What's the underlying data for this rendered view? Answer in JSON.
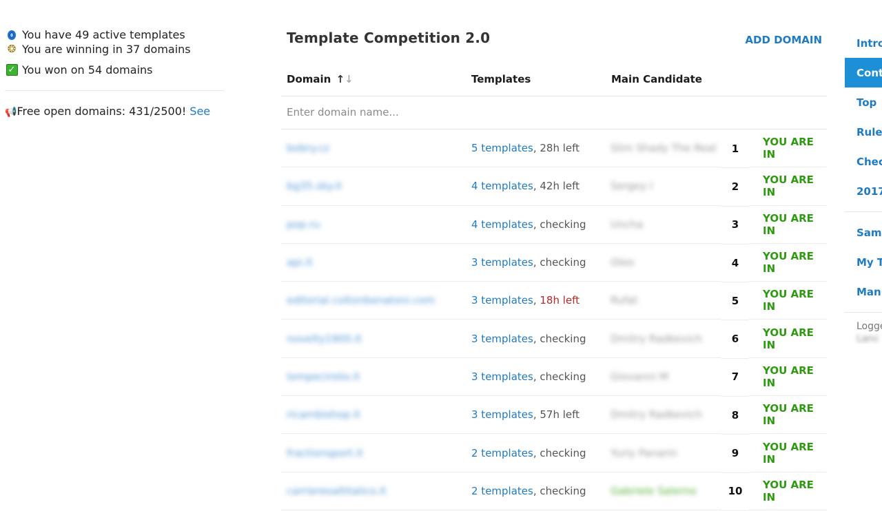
{
  "status": {
    "active_templates": "You have 49 active templates",
    "winning": "You are winning in 37 domains",
    "won": "You won on 54 domains",
    "free_domains": "Free open domains: 431/2500!",
    "see_link": "See"
  },
  "main": {
    "title": "Template Competition 2.0",
    "add_domain": "ADD DOMAIN"
  },
  "table": {
    "headers": {
      "domain": "Domain",
      "domain_sort_up": "↑",
      "domain_sort_down": "↓",
      "templates": "Templates",
      "candidate": "Main Candidate"
    },
    "search_placeholder": "Enter domain name...",
    "rows": [
      {
        "domain": "bobry.cz",
        "templates": "5 templates",
        "sep": ", ",
        "time": "28h left",
        "urgent": false,
        "candidate": "Slim Shady The Real",
        "rank": "1",
        "status": "YOU ARE IN"
      },
      {
        "domain": "bg35.sky.it",
        "templates": "4 templates",
        "sep": ", ",
        "time": "42h left",
        "urgent": false,
        "candidate": "Sergey I",
        "rank": "2",
        "status": "YOU ARE IN"
      },
      {
        "domain": "pop.ru",
        "templates": "4 templates",
        "sep": ", ",
        "time": "checking",
        "urgent": false,
        "candidate": "Uncha",
        "rank": "3",
        "status": "YOU ARE IN"
      },
      {
        "domain": "api.it",
        "templates": "3 templates",
        "sep": ", ",
        "time": "checking",
        "urgent": false,
        "candidate": "Oleo",
        "rank": "4",
        "status": "YOU ARE IN"
      },
      {
        "domain": "editorial.coltonbenatoni.com",
        "templates": "3 templates",
        "sep": ", ",
        "time": "18h left",
        "urgent": true,
        "candidate": "Rufat",
        "rank": "5",
        "status": "YOU ARE IN"
      },
      {
        "domain": "novelty1900.it",
        "templates": "3 templates",
        "sep": ", ",
        "time": "checking",
        "urgent": false,
        "candidate": "Dmitry Radkevich",
        "rank": "6",
        "status": "YOU ARE IN"
      },
      {
        "domain": "lompecirolio.it",
        "templates": "3 templates",
        "sep": ", ",
        "time": "checking",
        "urgent": false,
        "candidate": "Giovanni M",
        "rank": "7",
        "status": "YOU ARE IN"
      },
      {
        "domain": "ricambishop.it",
        "templates": "3 templates",
        "sep": ", ",
        "time": "57h left",
        "urgent": false,
        "candidate": "Dmitry Radkevich",
        "rank": "8",
        "status": "YOU ARE IN"
      },
      {
        "domain": "fractionsport.it",
        "templates": "2 templates",
        "sep": ", ",
        "time": "checking",
        "urgent": false,
        "candidate": "Yuriy Panarin",
        "rank": "9",
        "status": "YOU ARE IN"
      },
      {
        "domain": "carrieresaltitalico.it",
        "templates": "2 templates",
        "sep": ", ",
        "time": "checking",
        "urgent": false,
        "candidate": "Gabriele Salerno",
        "rank": "10",
        "status": "YOU ARE IN",
        "green": true
      }
    ]
  },
  "nav": {
    "items": [
      "Intro",
      "Cont",
      "Top",
      "Rules",
      "Chec",
      "2017"
    ],
    "items2": [
      "Samp",
      "My T",
      "Manu"
    ],
    "logged": "Logge",
    "user": "Lanc"
  },
  "colors": {
    "link": "#1f7bc1",
    "status_green": "#2e9a10",
    "urgent_red": "#b02a2a",
    "nav_active": "#1d8fd6"
  }
}
